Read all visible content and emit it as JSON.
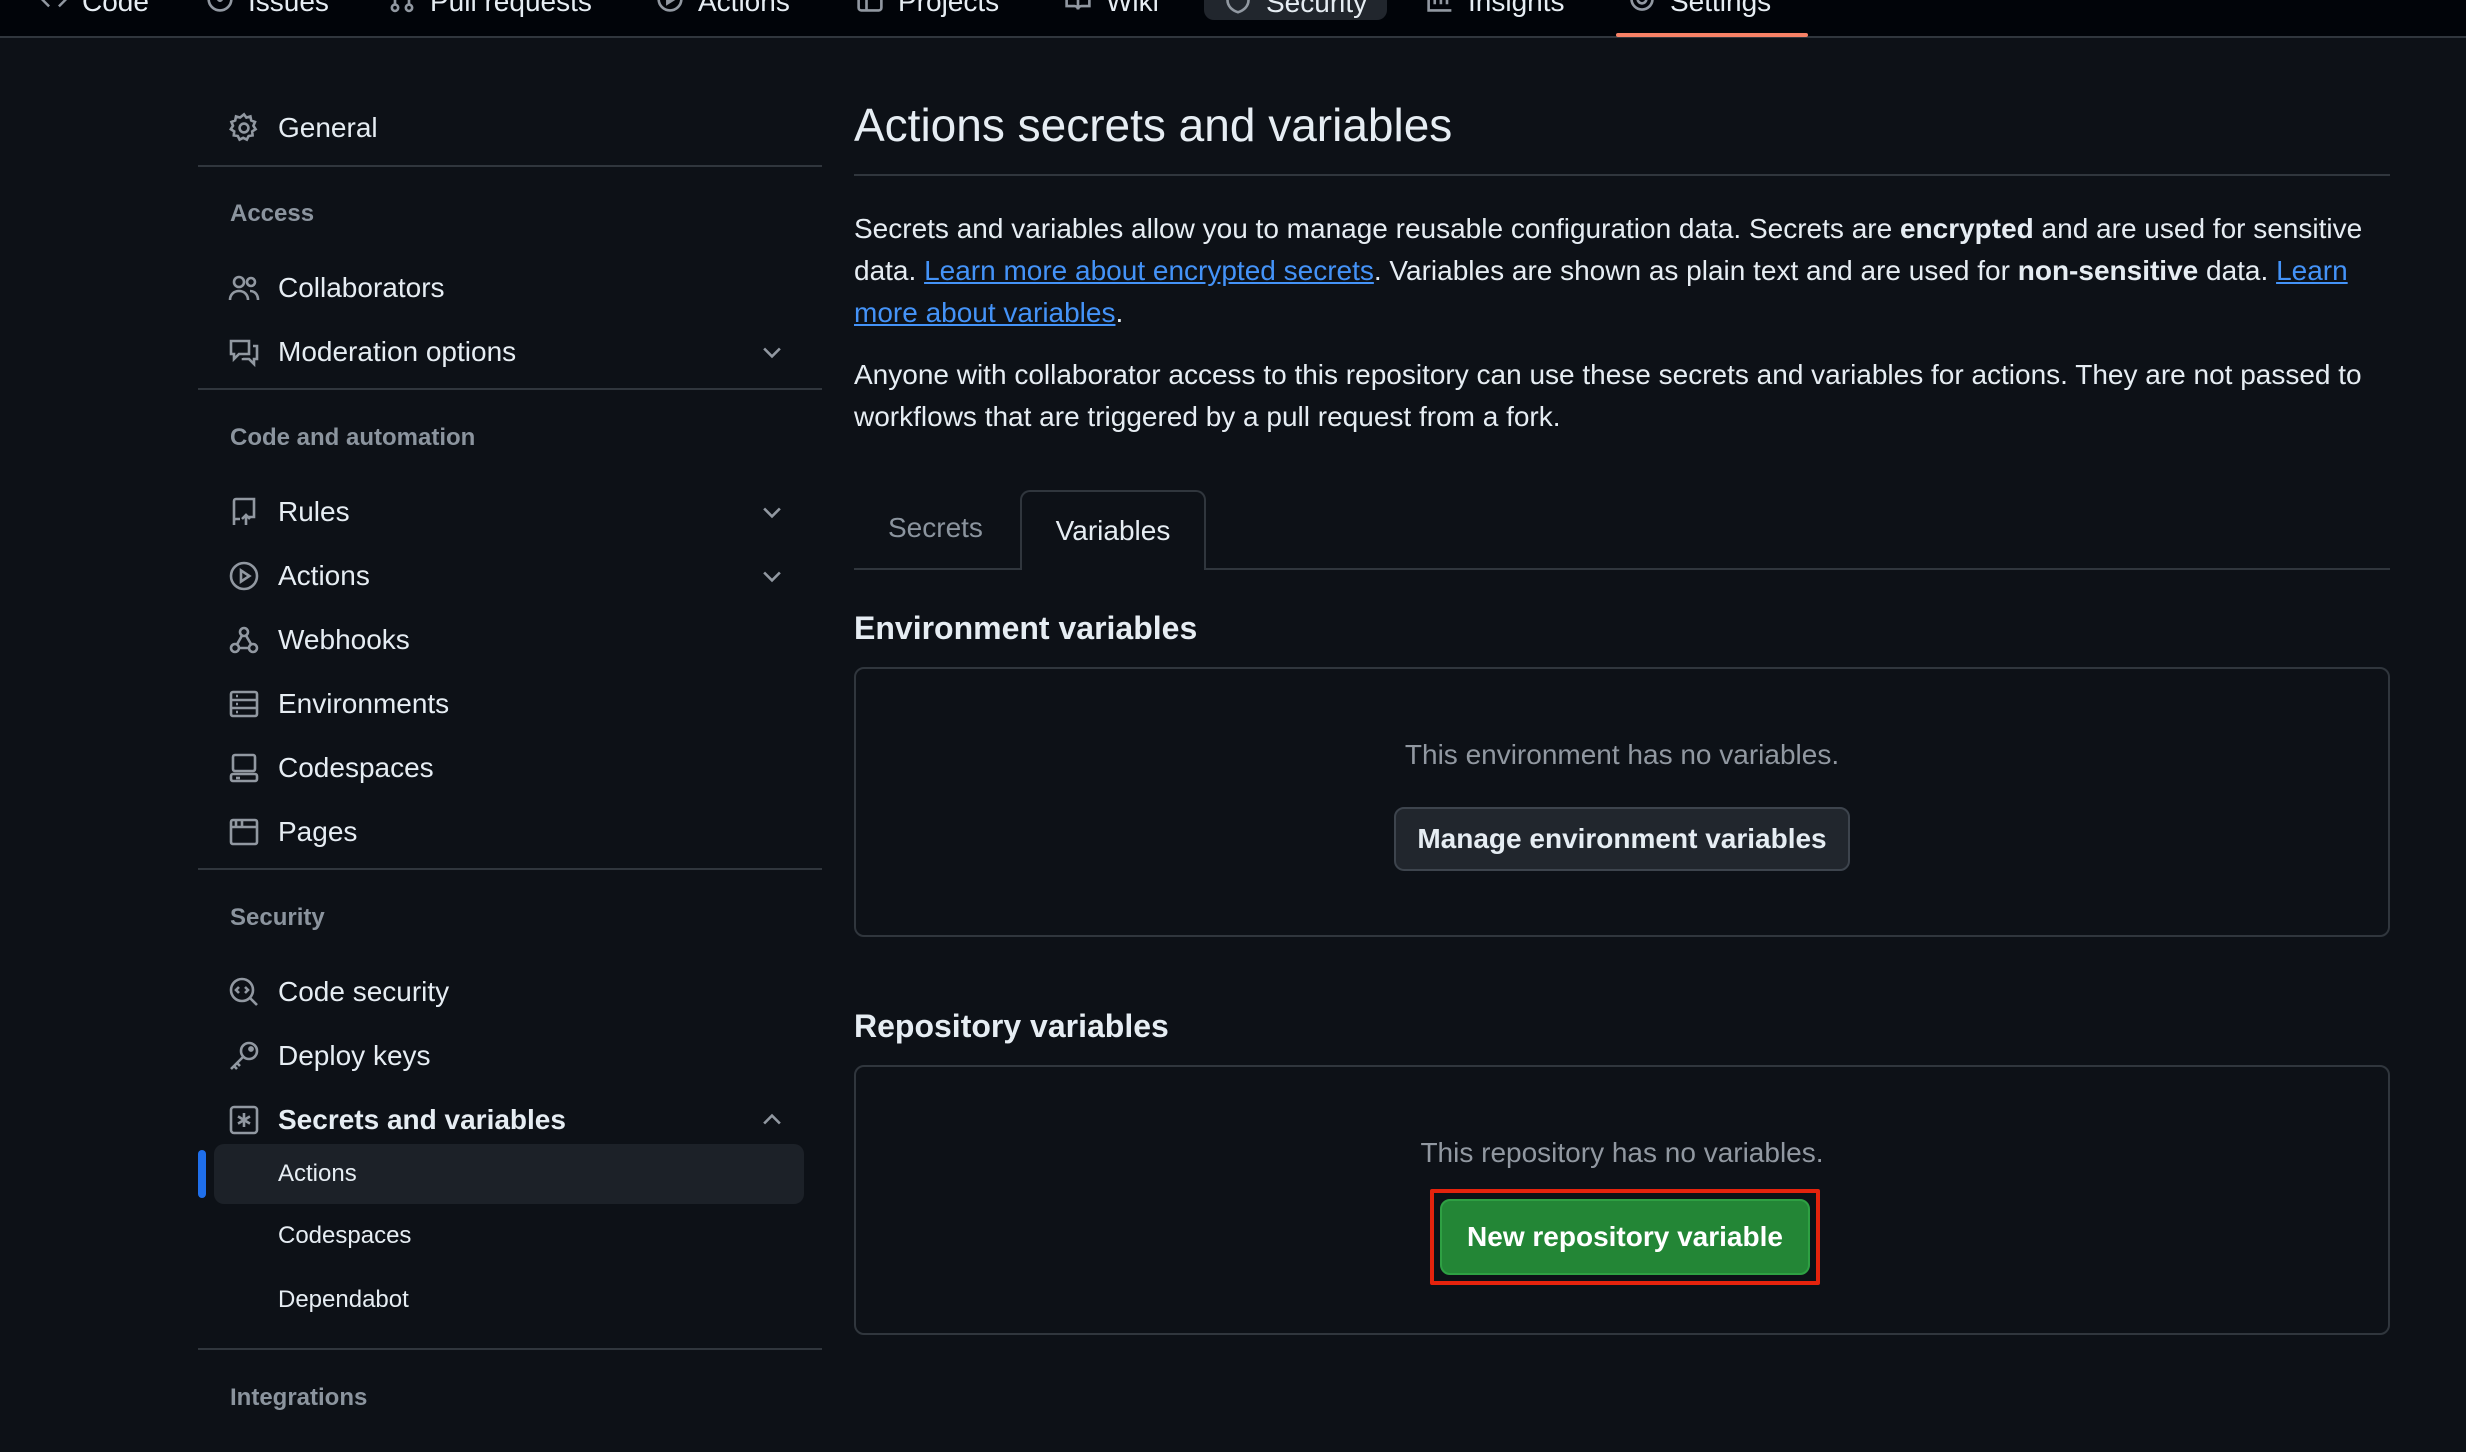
{
  "topnav": {
    "tabs": [
      {
        "label": "Code",
        "icon": "code-icon"
      },
      {
        "label": "Issues",
        "icon": "issue-icon"
      },
      {
        "label": "Pull requests",
        "icon": "pull-request-icon"
      },
      {
        "label": "Actions",
        "icon": "play-icon"
      },
      {
        "label": "Projects",
        "icon": "table-icon"
      },
      {
        "label": "Wiki",
        "icon": "book-icon"
      },
      {
        "label": "Security",
        "icon": "shield-icon"
      },
      {
        "label": "Insights",
        "icon": "graph-icon"
      },
      {
        "label": "Settings",
        "icon": "gear-icon"
      }
    ],
    "selected": "Settings"
  },
  "sidebar": {
    "general": "General",
    "access_heading": "Access",
    "collaborators": "Collaborators",
    "moderation": "Moderation options",
    "code_heading": "Code and automation",
    "rules": "Rules",
    "actions": "Actions",
    "webhooks": "Webhooks",
    "environments": "Environments",
    "codespaces": "Codespaces",
    "pages": "Pages",
    "security_heading": "Security",
    "code_security": "Code security",
    "deploy_keys": "Deploy keys",
    "secrets_vars": "Secrets and variables",
    "sub_actions": "Actions",
    "sub_codespaces": "Codespaces",
    "sub_dependabot": "Dependabot",
    "integrations_heading": "Integrations"
  },
  "main": {
    "title": "Actions secrets and variables",
    "p1_a": "Secrets and variables allow you to manage reusable configuration data. Secrets are ",
    "p1_b": "encrypted",
    "p1_c": " and are used for sensitive data. ",
    "p1_link1": "Learn more about encrypted secrets",
    "p1_d": ". Variables are shown as plain text and are used for ",
    "p1_e": "non-sensitive",
    "p1_f": " data. ",
    "p1_link2": "Learn more about variables",
    "p1_g": ".",
    "p2": "Anyone with collaborator access to this repository can use these secrets and variables for actions. They are not passed to workflows that are triggered by a pull request from a fork.",
    "tabs": [
      "Secrets",
      "Variables"
    ],
    "env_title": "Environment variables",
    "env_empty": "This environment has no variables.",
    "env_button": "Manage environment variables",
    "repo_title": "Repository variables",
    "repo_empty": "This repository has no variables.",
    "repo_button": "New repository variable"
  }
}
